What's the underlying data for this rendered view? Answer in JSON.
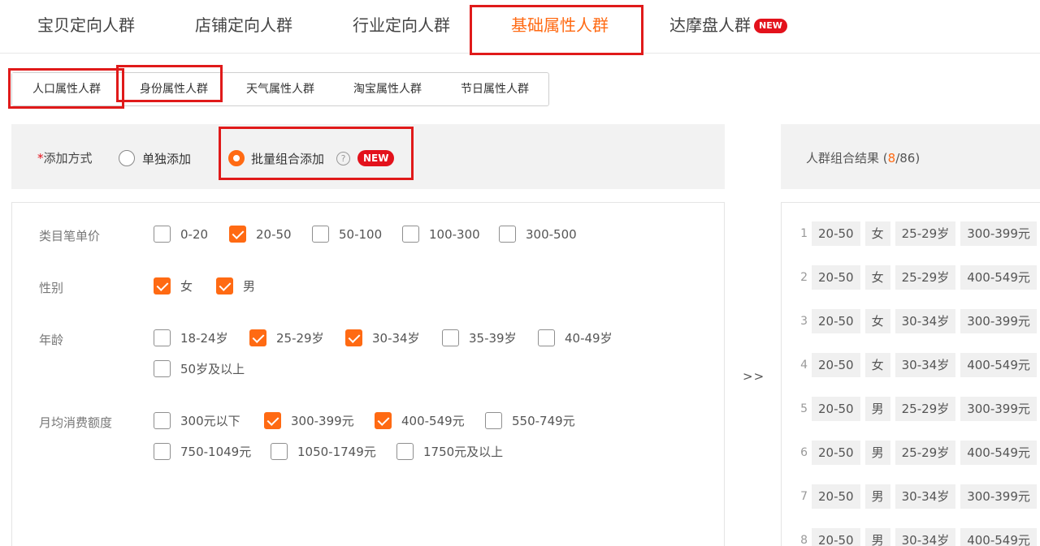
{
  "top_tabs": [
    {
      "label": "宝贝定向人群",
      "active": false
    },
    {
      "label": "店铺定向人群",
      "active": false
    },
    {
      "label": "行业定向人群",
      "active": false
    },
    {
      "label": "基础属性人群",
      "active": true
    },
    {
      "label": "达摩盘人群",
      "active": false,
      "badge": "NEW"
    }
  ],
  "sub_tabs": [
    {
      "label": "人口属性人群",
      "active": true
    },
    {
      "label": "身份属性人群",
      "active": false
    },
    {
      "label": "天气属性人群",
      "active": false
    },
    {
      "label": "淘宝属性人群",
      "active": false
    },
    {
      "label": "节日属性人群",
      "active": false
    }
  ],
  "add_mode": {
    "required_mark": "*",
    "label": "添加方式",
    "options": [
      {
        "label": "单独添加",
        "selected": false
      },
      {
        "label": "批量组合添加",
        "selected": true
      }
    ],
    "help_icon": "?",
    "badge": "NEW"
  },
  "filters": {
    "price": {
      "label": "类目笔单价",
      "options": [
        {
          "label": "0-20",
          "checked": false
        },
        {
          "label": "20-50",
          "checked": true
        },
        {
          "label": "50-100",
          "checked": false
        },
        {
          "label": "100-300",
          "checked": false
        },
        {
          "label": "300-500",
          "checked": false
        }
      ]
    },
    "gender": {
      "label": "性别",
      "options": [
        {
          "label": "女",
          "checked": true
        },
        {
          "label": "男",
          "checked": true
        }
      ]
    },
    "age": {
      "label": "年龄",
      "options": [
        {
          "label": "18-24岁",
          "checked": false
        },
        {
          "label": "25-29岁",
          "checked": true
        },
        {
          "label": "30-34岁",
          "checked": true
        },
        {
          "label": "35-39岁",
          "checked": false
        },
        {
          "label": "40-49岁",
          "checked": false
        },
        {
          "label": "50岁及以上",
          "checked": false
        }
      ]
    },
    "spend": {
      "label": "月均消费额度",
      "options": [
        {
          "label": "300元以下",
          "checked": false
        },
        {
          "label": "300-399元",
          "checked": true
        },
        {
          "label": "400-549元",
          "checked": true
        },
        {
          "label": "550-749元",
          "checked": false
        },
        {
          "label": "750-1049元",
          "checked": false
        },
        {
          "label": "1050-1749元",
          "checked": false
        },
        {
          "label": "1750元及以上",
          "checked": false
        }
      ]
    }
  },
  "transfer_arrows": ">>",
  "result": {
    "title": "人群组合结果",
    "open": " (",
    "count": "8",
    "total": "/86)",
    "rows": [
      {
        "index": "1",
        "tags": [
          "20-50",
          "女",
          "25-29岁",
          "300-399元"
        ]
      },
      {
        "index": "2",
        "tags": [
          "20-50",
          "女",
          "25-29岁",
          "400-549元"
        ]
      },
      {
        "index": "3",
        "tags": [
          "20-50",
          "女",
          "30-34岁",
          "300-399元"
        ]
      },
      {
        "index": "4",
        "tags": [
          "20-50",
          "女",
          "30-34岁",
          "400-549元"
        ]
      },
      {
        "index": "5",
        "tags": [
          "20-50",
          "男",
          "25-29岁",
          "300-399元"
        ]
      },
      {
        "index": "6",
        "tags": [
          "20-50",
          "男",
          "25-29岁",
          "400-549元"
        ]
      },
      {
        "index": "7",
        "tags": [
          "20-50",
          "男",
          "30-34岁",
          "300-399元"
        ]
      },
      {
        "index": "8",
        "tags": [
          "20-50",
          "男",
          "30-34岁",
          "400-549元"
        ]
      }
    ]
  }
}
